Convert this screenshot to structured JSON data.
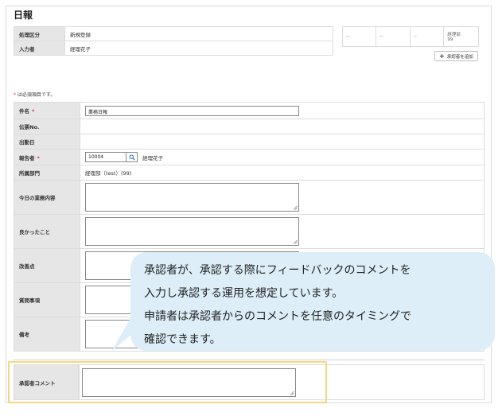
{
  "page": {
    "title": "日報"
  },
  "top_fields": [
    {
      "label": "処理区分",
      "value": "新規登録"
    },
    {
      "label": "入力者",
      "value": "経理花子"
    }
  ],
  "approvers": {
    "slots": [
      "--",
      "--",
      "--"
    ],
    "assigned": {
      "department": "経理部",
      "code": "99"
    },
    "add_button_label": "承認者を追加"
  },
  "required_note": {
    "star": "*",
    "text": "は必須項目です。"
  },
  "form": {
    "subject": {
      "label": "件名",
      "required": true,
      "value": "業務日報"
    },
    "slip_no": {
      "label": "伝票No."
    },
    "attendance_date": {
      "label": "出勤日"
    },
    "reporter": {
      "label": "報告者",
      "required": true,
      "code": "10004",
      "name": "経理花子"
    },
    "department": {
      "label": "所属部門",
      "value": "経理部（test）(99)"
    },
    "today_work": {
      "label": "今日の業務内容"
    },
    "good_things": {
      "label": "良かったこと"
    },
    "improvements": {
      "label": "改善点"
    },
    "questions": {
      "label": "質問事項"
    },
    "remarks": {
      "label": "備考"
    },
    "approver_comment": {
      "label": "承認者コメント"
    }
  },
  "required_mark": "*",
  "callout": {
    "lines": [
      "承認者が、承認する際にフィードバックのコメントを",
      "入力し承認する運用を想定しています。",
      "申請者は承認者からのコメントを任意のタイミングで",
      "確認できます。"
    ],
    "background": "#ddeef8"
  },
  "colors": {
    "label_bg": "#e6e6e6",
    "required": "#d9304d",
    "highlight": "#f5d77e"
  },
  "icons": {
    "search": "search-icon",
    "add": "plus-icon",
    "resize": "resize-grip-icon"
  }
}
